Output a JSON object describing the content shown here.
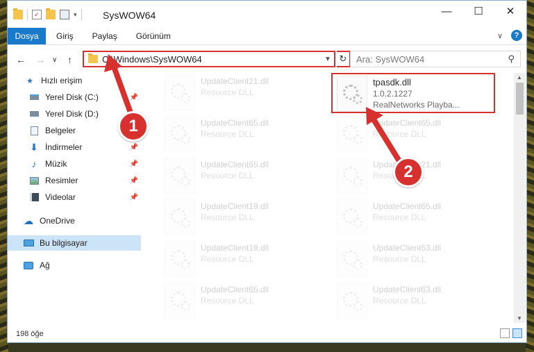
{
  "window": {
    "title": "SysWOW64",
    "minimize": "—",
    "maximize": "☐",
    "close": "✕"
  },
  "ribbon": {
    "tabs": [
      "Dosya",
      "Giriş",
      "Paylaş",
      "Görünüm"
    ],
    "expand": "∨",
    "help": "?"
  },
  "nav": {
    "back": "←",
    "forward": "→",
    "recent": "∨",
    "up": "↑",
    "address": "C:\\Windows\\SysWOW64",
    "search_placeholder": "Ara: SysWOW64"
  },
  "sidebar": {
    "items": [
      {
        "label": "Hızlı erişim",
        "icon": "star-icon"
      },
      {
        "label": "Yerel Disk (C:)",
        "icon": "drive-icon"
      },
      {
        "label": "Yerel Disk (D:)",
        "icon": "drive-icon"
      },
      {
        "label": "Belgeler",
        "icon": "documents-icon"
      },
      {
        "label": "İndirmeler",
        "icon": "download-icon"
      },
      {
        "label": "Müzik",
        "icon": "music-icon"
      },
      {
        "label": "Resimler",
        "icon": "pictures-icon"
      },
      {
        "label": "Videolar",
        "icon": "video-icon"
      },
      {
        "label": "OneDrive",
        "icon": "cloud-icon"
      },
      {
        "label": "Bu bilgisayar",
        "icon": "computer-icon"
      },
      {
        "label": "Ağ",
        "icon": "network-icon"
      }
    ]
  },
  "files": {
    "left": [
      {
        "name": "UpdateClient21.dll",
        "type": "Resource DLL"
      },
      {
        "name": "UpdateClient65.dll",
        "type": "Resource DLL"
      },
      {
        "name": "UpdateClient65.dll",
        "type": "Resource DLL"
      },
      {
        "name": "UpdateClient19.dll",
        "type": "Resource DLL"
      },
      {
        "name": "UpdateClient19.dll",
        "type": "Resource DLL"
      },
      {
        "name": "UpdateClient65.dll",
        "type": "Resource DLL"
      }
    ],
    "right": [
      {
        "name": "tpasdk.dll",
        "version": "1.0.2.1227",
        "type": "RealNetworks Playba..."
      },
      {
        "name": "UpdateClient65.dll",
        "type": "Resource DLL"
      },
      {
        "name": "UpdateClient21.dll",
        "type": "Resource DLL"
      },
      {
        "name": "UpdateClient65.dll",
        "type": "Resource DLL"
      },
      {
        "name": "UpdateClient63.dll",
        "type": "Resource DLL"
      },
      {
        "name": "UpdateClient63.dll",
        "type": "Resource DLL"
      }
    ]
  },
  "status": {
    "count": "198 öğe"
  },
  "callouts": {
    "one": "1",
    "two": "2"
  },
  "colors": {
    "accent": "#1979ca",
    "highlight_red": "#d6312f",
    "selected_bg": "#cce4f7"
  }
}
